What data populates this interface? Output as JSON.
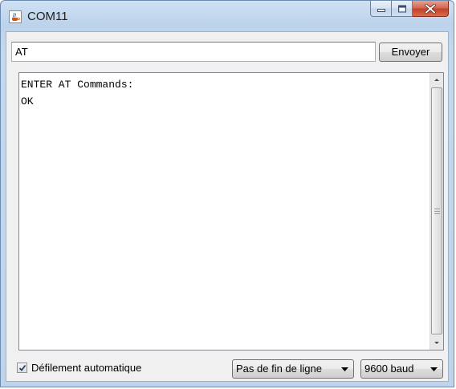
{
  "window": {
    "title": "COM11",
    "app_icon": "java-coffee-icon"
  },
  "caption_buttons": {
    "minimize_icon": "minimize-icon",
    "maximize_icon": "maximize-icon",
    "close_icon": "close-icon"
  },
  "send": {
    "input_value": "AT",
    "button_label": "Envoyer"
  },
  "output": {
    "lines": [
      "ENTER AT Commands:",
      "OK"
    ]
  },
  "footer": {
    "autoscroll_label": "Défilement automatique",
    "autoscroll_checked": true,
    "line_ending": "Pas de fin de ligne",
    "baud_rate": "9600 baud"
  },
  "colors": {
    "close_button": "#c2422a",
    "title_gradient": "#bcd3ec"
  }
}
